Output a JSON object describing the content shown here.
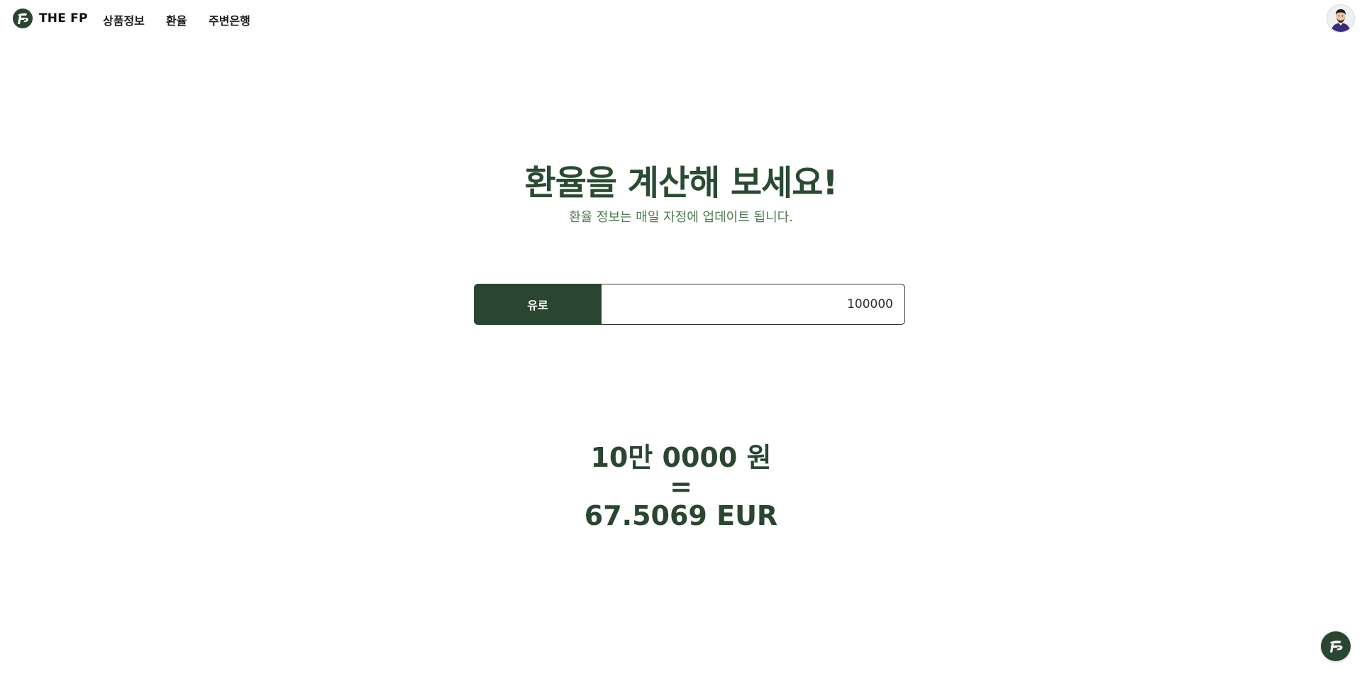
{
  "nav": {
    "brand": "THE FP",
    "links": [
      {
        "label": "상품정보"
      },
      {
        "label": "환율"
      },
      {
        "label": "주변은행"
      }
    ]
  },
  "hero": {
    "title": "환율을 계산해 보세요!",
    "subtitle": "환율 정보는 매일 자정에 업데이트 됩니다."
  },
  "converter": {
    "currency_label": "유로",
    "amount_value": "100000"
  },
  "result": {
    "krw": "10만 0000 원",
    "equals": "=",
    "foreign": "67.5069 EUR"
  },
  "colors": {
    "primary": "#2a4530",
    "title": "#2a4a31",
    "subtitle": "#4c7a52"
  },
  "icons": {
    "brand": "fp-logo-icon",
    "avatar": "user-avatar-icon",
    "floating": "fp-logo-icon"
  }
}
